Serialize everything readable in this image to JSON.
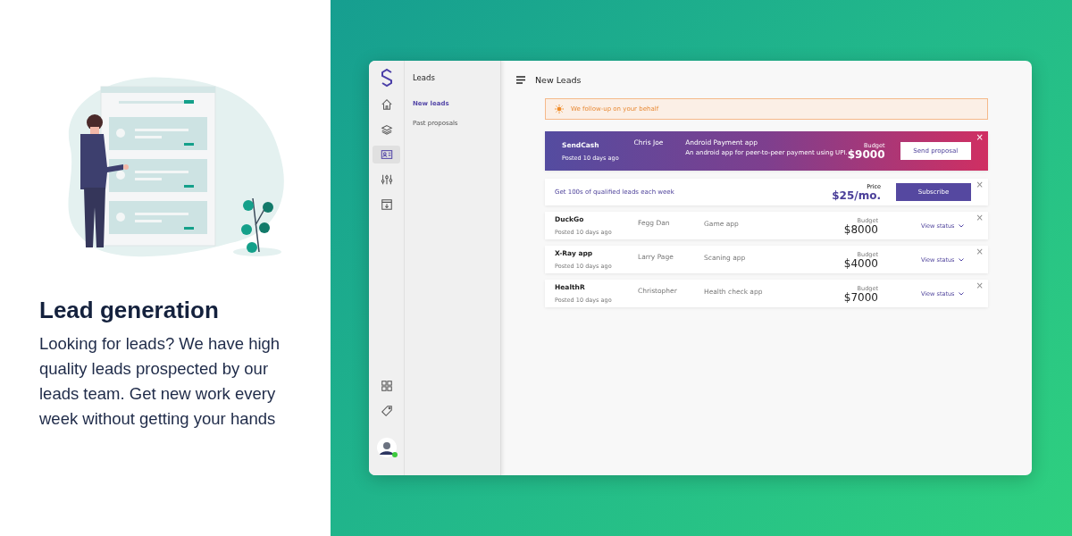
{
  "promo": {
    "title": "Lead generation",
    "text": "Looking for leads? We have high quality leads prospected by our leads team. Get new work every week without getting your hands"
  },
  "app": {
    "rail": [
      {
        "selected": false
      },
      {
        "selected": false
      },
      {
        "selected": true
      },
      {
        "selected": false
      },
      {
        "selected": false
      }
    ],
    "sidebar": {
      "title": "Leads",
      "items": [
        {
          "label": "New leads",
          "selected": true
        },
        {
          "label": "Past proposals",
          "selected": false
        }
      ]
    },
    "header": {
      "title": "New Leads"
    },
    "notice": "We follow-up on your behalf",
    "featured": {
      "name": "SendCash",
      "posted": "Posted 10 days ago",
      "client": "Chris Joe",
      "project": "Android Payment app",
      "description": "An android app for peer-to-peer payment using UPI.",
      "budget_label": "Budget",
      "budget": "$9000",
      "button": "Send proposal",
      "close": "×"
    },
    "subscribe": {
      "text": "Get 100s of qualified leads each week",
      "price_label": "Price",
      "price": "$25/mo.",
      "button": "Subscribe",
      "close": "×"
    },
    "leads": [
      {
        "name": "DuckGo",
        "posted": "Posted 10 days ago",
        "client": "Fegg Dan",
        "project": "Game app",
        "budget_label": "Budget",
        "budget": "$8000",
        "action": "View status",
        "close": "×"
      },
      {
        "name": "X-Ray app",
        "posted": "Posted 10 days ago",
        "client": "Larry Page",
        "project": "Scaning app",
        "budget_label": "Budget",
        "budget": "$4000",
        "action": "View status",
        "close": "×"
      },
      {
        "name": "HealthR",
        "posted": "Posted 10 days ago",
        "client": "Christopher",
        "project": "Health check app",
        "budget_label": "Budget",
        "budget": "$7000",
        "action": "View status",
        "close": "×"
      }
    ]
  }
}
